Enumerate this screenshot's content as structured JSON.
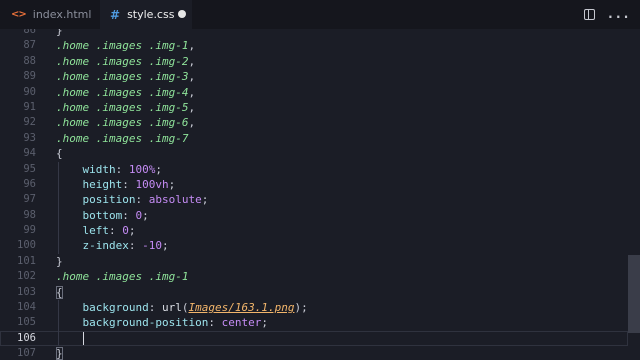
{
  "tabs": [
    {
      "icon": "<>",
      "label": "index.html",
      "active": false
    },
    {
      "icon": "#",
      "label": "style.css",
      "active": true,
      "unsaved": true
    }
  ],
  "actions": {
    "split_icon": "split-editor-icon",
    "more_icon": "..."
  },
  "editor": {
    "lines": [
      {
        "n": "86",
        "text": "}"
      },
      {
        "n": "87",
        "text": ".home .images .img-1,"
      },
      {
        "n": "88",
        "text": ".home .images .img-2,"
      },
      {
        "n": "89",
        "text": ".home .images .img-3,"
      },
      {
        "n": "90",
        "text": ".home .images .img-4,"
      },
      {
        "n": "91",
        "text": ".home .images .img-5,"
      },
      {
        "n": "92",
        "text": ".home .images .img-6,"
      },
      {
        "n": "93",
        "text": ".home .images .img-7"
      },
      {
        "n": "94",
        "text": "{"
      },
      {
        "n": "95",
        "prop": "width",
        "value": "100%"
      },
      {
        "n": "96",
        "prop": "height",
        "value": "100vh"
      },
      {
        "n": "97",
        "prop": "position",
        "value": "absolute"
      },
      {
        "n": "98",
        "prop": "bottom",
        "value": "0"
      },
      {
        "n": "99",
        "prop": "left",
        "value": "0"
      },
      {
        "n": "100",
        "prop": "z-index",
        "value": "-10"
      },
      {
        "n": "101",
        "text": "}"
      },
      {
        "n": "102",
        "text": ".home .images .img-1"
      },
      {
        "n": "103",
        "text": "{"
      },
      {
        "n": "104",
        "prop": "background",
        "fn": "url",
        "arg": "Images/163.1.png"
      },
      {
        "n": "105",
        "prop": "background-position",
        "value": "center"
      },
      {
        "n": "106",
        "text": ""
      },
      {
        "n": "107",
        "text": "}"
      }
    ],
    "current_line": "106"
  },
  "colors": {
    "background": "#1b1d26",
    "selector": "#8fe39a",
    "property": "#9ce3ec",
    "value": "#c58cf5",
    "url": "#f2b56b"
  }
}
